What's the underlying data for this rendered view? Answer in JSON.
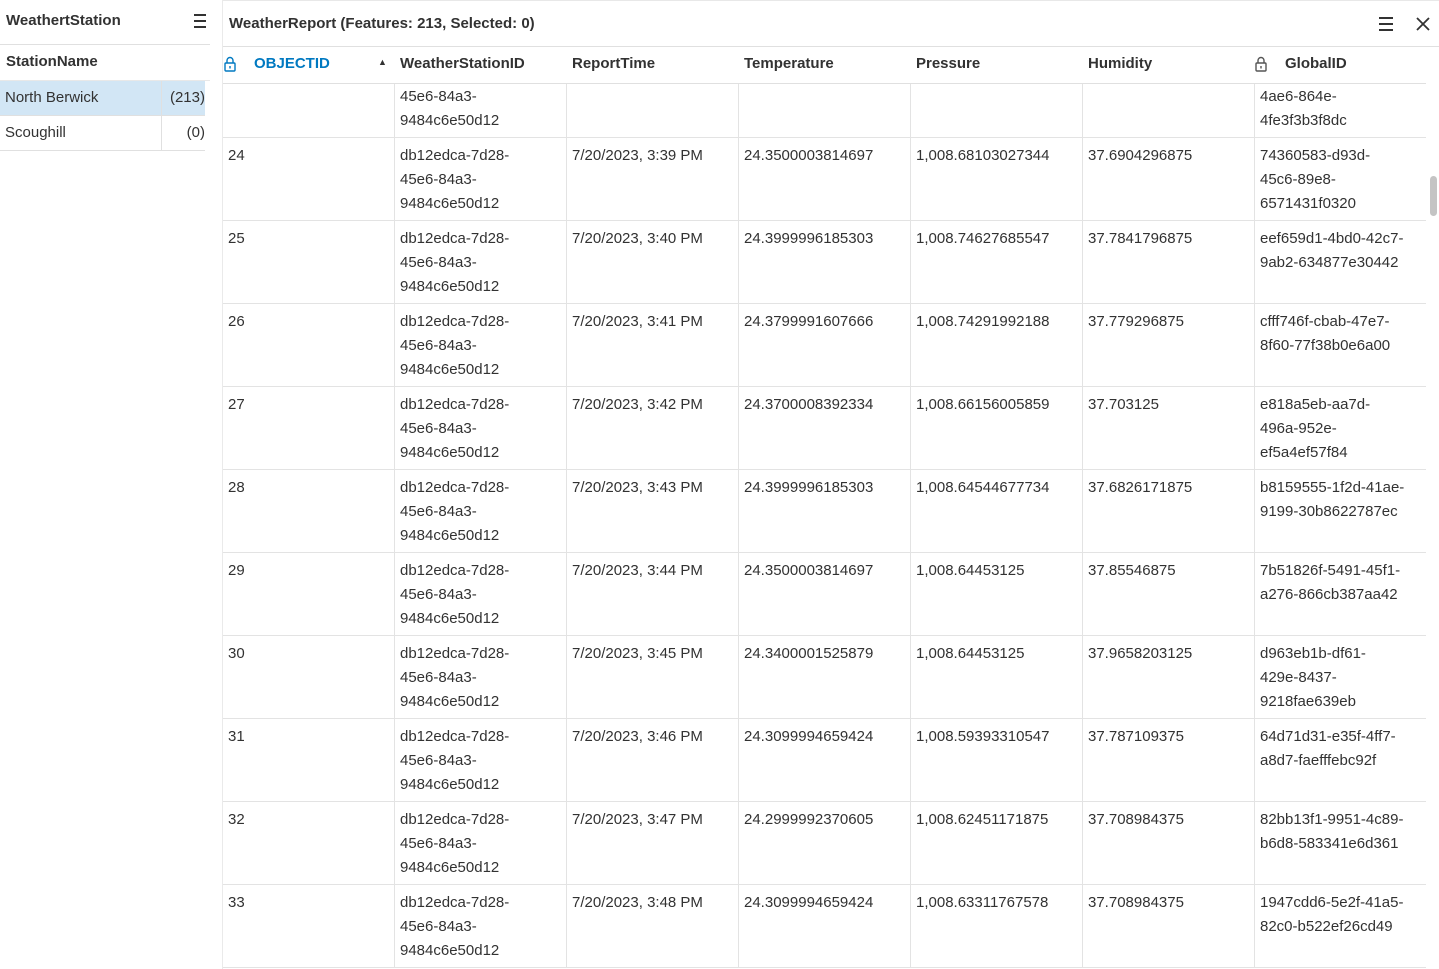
{
  "left_panel": {
    "title": "WeathertStation",
    "column_header": "StationName",
    "stations": [
      {
        "name": "North Berwick",
        "count": "(213)",
        "selected": true
      },
      {
        "name": "Scoughill",
        "count": "(0)",
        "selected": false
      }
    ]
  },
  "right_panel": {
    "title": "WeatherReport (Features: 213, Selected: 0)",
    "columns": [
      {
        "label": "OBJECTID",
        "locked": true,
        "sorted": "ascending",
        "active": true
      },
      {
        "label": "WeatherStationID",
        "locked": false
      },
      {
        "label": "ReportTime",
        "locked": false
      },
      {
        "label": "Temperature",
        "locked": false
      },
      {
        "label": "Pressure",
        "locked": false
      },
      {
        "label": "Humidity",
        "locked": false
      },
      {
        "label": "GlobalID",
        "locked": true
      }
    ],
    "partial_row": {
      "station": "45e6-84a3-\n9484c6e50d12",
      "globalid": "4ae6-864e-\n4fe3f3b3f8dc"
    },
    "rows": [
      {
        "objectid": "24",
        "station": "db12edca-7d28-\n45e6-84a3-\n9484c6e50d12",
        "time": "7/20/2023, 3:39 PM",
        "temperature": "24.3500003814697",
        "pressure": "1,008.68103027344",
        "humidity": "37.6904296875",
        "globalid": "74360583-d93d-\n45c6-89e8-\n6571431f0320"
      },
      {
        "objectid": "25",
        "station": "db12edca-7d28-\n45e6-84a3-\n9484c6e50d12",
        "time": "7/20/2023, 3:40 PM",
        "temperature": "24.3999996185303",
        "pressure": "1,008.74627685547",
        "humidity": "37.7841796875",
        "globalid": "eef659d1-4bd0-42c7-\n9ab2-634877e30442"
      },
      {
        "objectid": "26",
        "station": "db12edca-7d28-\n45e6-84a3-\n9484c6e50d12",
        "time": "7/20/2023, 3:41 PM",
        "temperature": "24.3799991607666",
        "pressure": "1,008.74291992188",
        "humidity": "37.779296875",
        "globalid": "cfff746f-cbab-47e7-\n8f60-77f38b0e6a00"
      },
      {
        "objectid": "27",
        "station": "db12edca-7d28-\n45e6-84a3-\n9484c6e50d12",
        "time": "7/20/2023, 3:42 PM",
        "temperature": "24.3700008392334",
        "pressure": "1,008.66156005859",
        "humidity": "37.703125",
        "globalid": "e818a5eb-aa7d-\n496a-952e-\nef5a4ef57f84"
      },
      {
        "objectid": "28",
        "station": "db12edca-7d28-\n45e6-84a3-\n9484c6e50d12",
        "time": "7/20/2023, 3:43 PM",
        "temperature": "24.3999996185303",
        "pressure": "1,008.64544677734",
        "humidity": "37.6826171875",
        "globalid": "b8159555-1f2d-41ae-\n9199-30b8622787ec"
      },
      {
        "objectid": "29",
        "station": "db12edca-7d28-\n45e6-84a3-\n9484c6e50d12",
        "time": "7/20/2023, 3:44 PM",
        "temperature": "24.3500003814697",
        "pressure": "1,008.64453125",
        "humidity": "37.85546875",
        "globalid": "7b51826f-5491-45f1-\na276-866cb387aa42"
      },
      {
        "objectid": "30",
        "station": "db12edca-7d28-\n45e6-84a3-\n9484c6e50d12",
        "time": "7/20/2023, 3:45 PM",
        "temperature": "24.3400001525879",
        "pressure": "1,008.64453125",
        "humidity": "37.9658203125",
        "globalid": "d963eb1b-df61-\n429e-8437-\n9218fae639eb"
      },
      {
        "objectid": "31",
        "station": "db12edca-7d28-\n45e6-84a3-\n9484c6e50d12",
        "time": "7/20/2023, 3:46 PM",
        "temperature": "24.3099994659424",
        "pressure": "1,008.59393310547",
        "humidity": "37.787109375",
        "globalid": "64d71d31-e35f-4ff7-\na8d7-faefffebc92f"
      },
      {
        "objectid": "32",
        "station": "db12edca-7d28-\n45e6-84a3-\n9484c6e50d12",
        "time": "7/20/2023, 3:47 PM",
        "temperature": "24.2999992370605",
        "pressure": "1,008.62451171875",
        "humidity": "37.708984375",
        "globalid": "82bb13f1-9951-4c89-\nb6d8-583341e6d361"
      },
      {
        "objectid": "33",
        "station": "db12edca-7d28-\n45e6-84a3-\n9484c6e50d12",
        "time": "7/20/2023, 3:48 PM",
        "temperature": "24.3099994659424",
        "pressure": "1,008.63311767578",
        "humidity": "37.708984375",
        "globalid": "1947cdd6-5e2f-41a5-\n82c0-b522ef26cd49"
      }
    ]
  },
  "icons": {
    "menu": "hamburger-menu-icon",
    "close": "close-icon",
    "lock": "lock-icon",
    "sort": "sort-ascending-icon"
  },
  "colors": {
    "accent": "#0079c1",
    "selected_row": "#d2e6f5",
    "text": "#323232"
  }
}
